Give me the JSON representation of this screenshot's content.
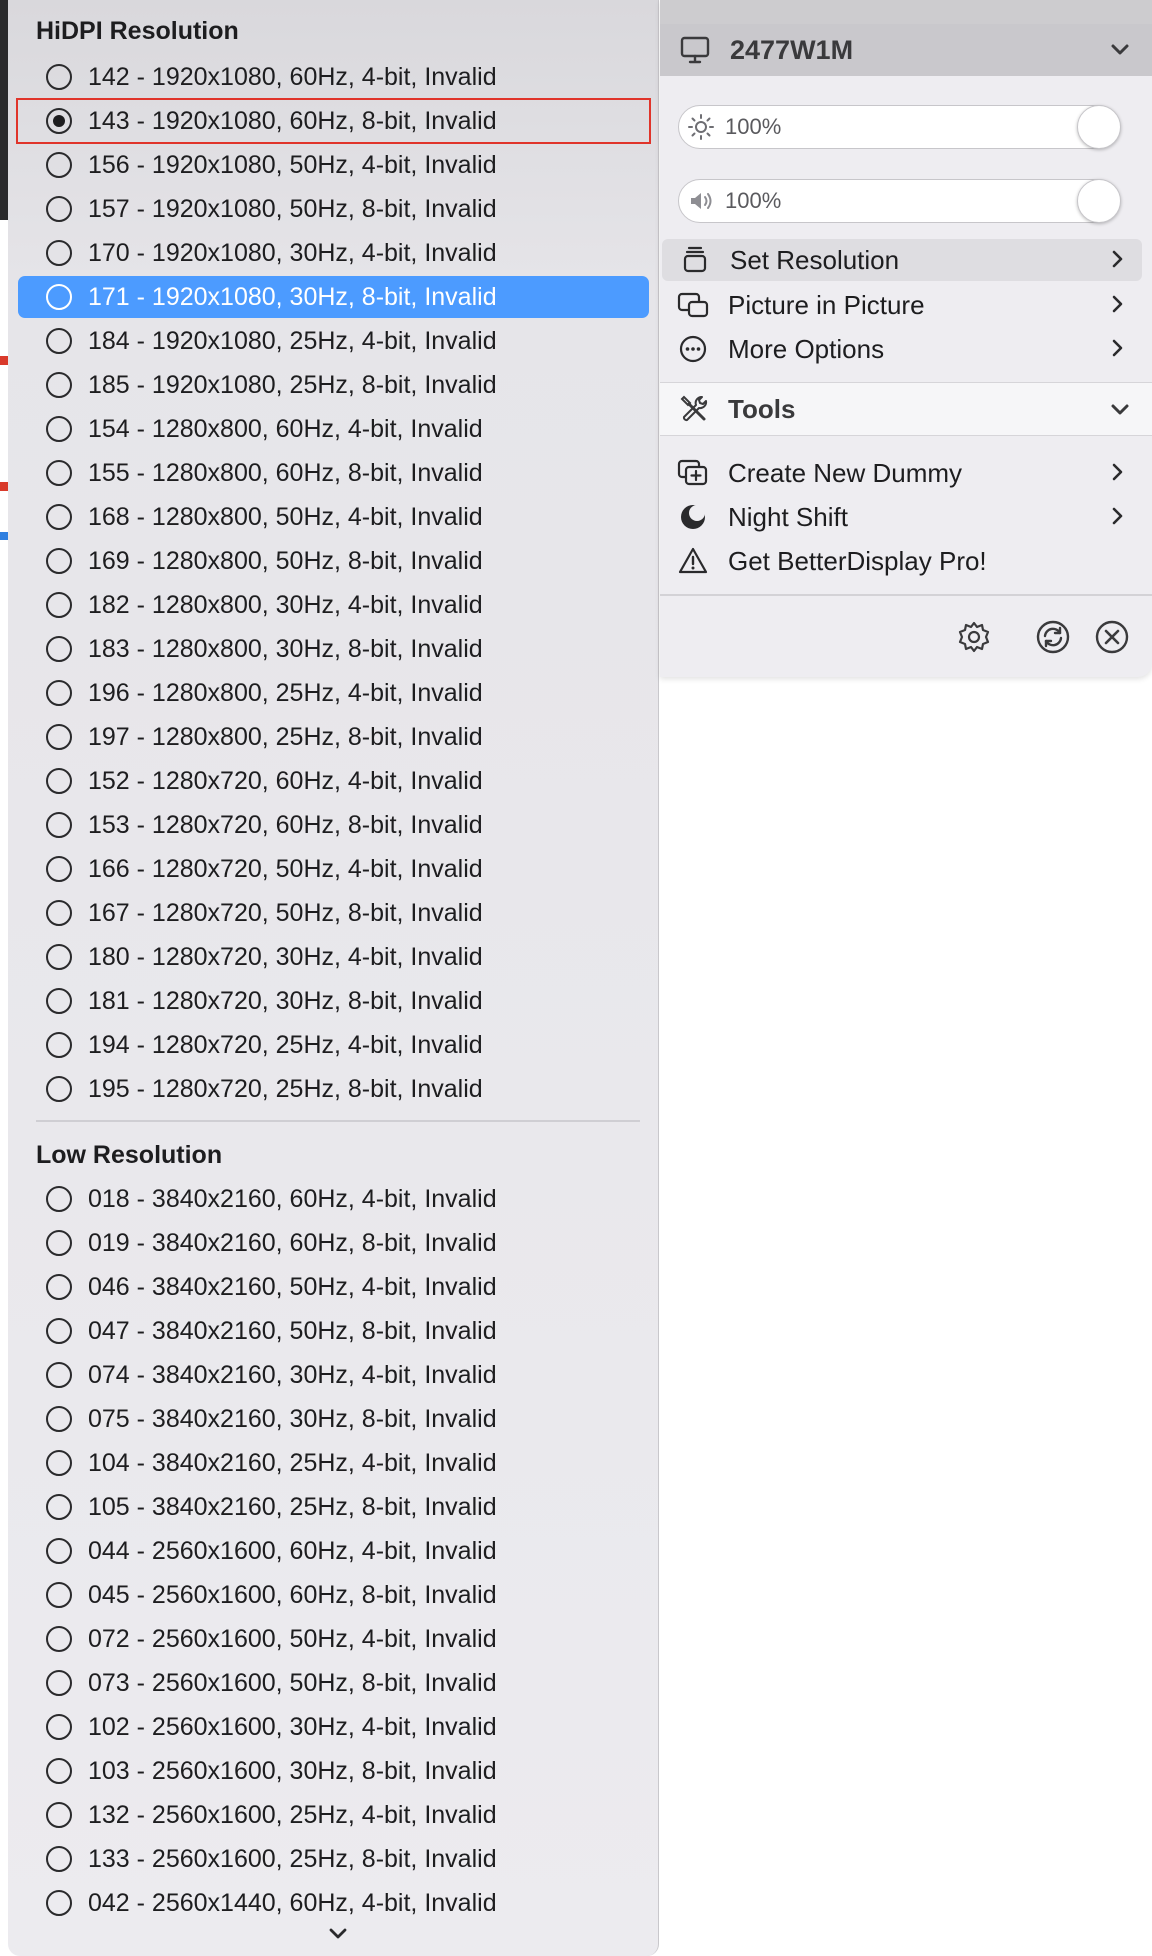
{
  "submenu": {
    "hidpi_header": "HiDPI Resolution",
    "low_header": "Low Resolution",
    "hidpi_items": [
      "142 - 1920x1080, 60Hz, 4-bit, Invalid",
      "143 - 1920x1080, 60Hz, 8-bit, Invalid",
      "156 - 1920x1080, 50Hz, 4-bit, Invalid",
      "157 - 1920x1080, 50Hz, 8-bit, Invalid",
      "170 - 1920x1080, 30Hz, 4-bit, Invalid",
      "171 - 1920x1080, 30Hz, 8-bit, Invalid",
      "184 - 1920x1080, 25Hz, 4-bit, Invalid",
      "185 - 1920x1080, 25Hz, 8-bit, Invalid",
      "154 - 1280x800, 60Hz, 4-bit, Invalid",
      "155 - 1280x800, 60Hz, 8-bit, Invalid",
      "168 - 1280x800, 50Hz, 4-bit, Invalid",
      "169 - 1280x800, 50Hz, 8-bit, Invalid",
      "182 - 1280x800, 30Hz, 4-bit, Invalid",
      "183 - 1280x800, 30Hz, 8-bit, Invalid",
      "196 - 1280x800, 25Hz, 4-bit, Invalid",
      "197 - 1280x800, 25Hz, 8-bit, Invalid",
      "152 - 1280x720, 60Hz, 4-bit, Invalid",
      "153 - 1280x720, 60Hz, 8-bit, Invalid",
      "166 - 1280x720, 50Hz, 4-bit, Invalid",
      "167 - 1280x720, 50Hz, 8-bit, Invalid",
      "180 - 1280x720, 30Hz, 4-bit, Invalid",
      "181 - 1280x720, 30Hz, 8-bit, Invalid",
      "194 - 1280x720, 25Hz, 4-bit, Invalid",
      "195 - 1280x720, 25Hz, 8-bit, Invalid"
    ],
    "low_items": [
      "018 - 3840x2160, 60Hz, 4-bit, Invalid",
      "019 - 3840x2160, 60Hz, 8-bit, Invalid",
      "046 - 3840x2160, 50Hz, 4-bit, Invalid",
      "047 - 3840x2160, 50Hz, 8-bit, Invalid",
      "074 - 3840x2160, 30Hz, 4-bit, Invalid",
      "075 - 3840x2160, 30Hz, 8-bit, Invalid",
      "104 - 3840x2160, 25Hz, 4-bit, Invalid",
      "105 - 3840x2160, 25Hz, 8-bit, Invalid",
      "044 - 2560x1600, 60Hz, 4-bit, Invalid",
      "045 - 2560x1600, 60Hz, 8-bit, Invalid",
      "072 - 2560x1600, 50Hz, 4-bit, Invalid",
      "073 - 2560x1600, 50Hz, 8-bit, Invalid",
      "102 - 2560x1600, 30Hz, 4-bit, Invalid",
      "103 - 2560x1600, 30Hz, 8-bit, Invalid",
      "132 - 2560x1600, 25Hz, 4-bit, Invalid",
      "133 - 2560x1600, 25Hz, 8-bit, Invalid",
      "042 - 2560x1440, 60Hz, 4-bit, Invalid"
    ],
    "selected_item": "143 - 1920x1080, 60Hz, 8-bit, Invalid",
    "highlighted_item": "171 - 1920x1080, 30Hz, 8-bit, Invalid"
  },
  "menu": {
    "display_name": "2477W1M",
    "brightness": {
      "label": "100%",
      "value_percent": 100
    },
    "volume": {
      "label": "100%",
      "value_percent": 100
    },
    "items": {
      "set_resolution": "Set Resolution",
      "picture_in_picture": "Picture in Picture",
      "more_options": "More Options"
    },
    "tools_header": "Tools",
    "tools_items": {
      "create_new_dummy": "Create New Dummy",
      "night_shift": "Night Shift",
      "get_pro": "Get BetterDisplay Pro!"
    }
  },
  "colors": {
    "highlight": "#4c9bff",
    "selection_outline": "#e0342a"
  },
  "icons": [
    "monitor-icon",
    "chevron-down-icon",
    "brightness-icon",
    "volume-icon",
    "layers-icon",
    "picture-in-picture-icon",
    "ellipsis-circle-icon",
    "chevron-right-icon",
    "tools-icon",
    "add-display-icon",
    "moon-icon",
    "warning-icon",
    "gear-icon",
    "refresh-icon",
    "close-icon",
    "radio-icon"
  ]
}
